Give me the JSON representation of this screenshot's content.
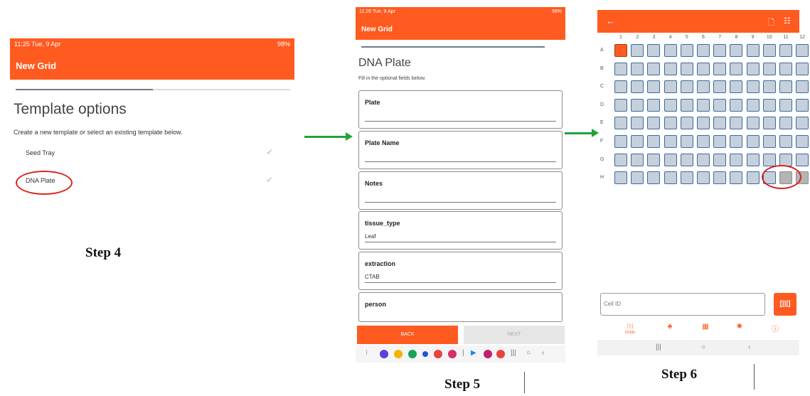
{
  "step4": {
    "status_left": "11:25 Tue, 9 Apr",
    "status_right": "98%",
    "title": "New Grid",
    "progress": 0.5,
    "heading": "Template options",
    "subtitle": "Create a new template or select an existing template below.",
    "options": [
      "Seed Tray",
      "DNA Plate"
    ],
    "step_label": "Step 4"
  },
  "step5": {
    "status_left": "11:26 Tue, 9 Apr",
    "status_right": "98%",
    "title": "New Grid",
    "progress": 0.9,
    "heading": "DNA Plate",
    "subtitle": "Fill in the optional fields below.",
    "fields": [
      {
        "label": "Plate",
        "value": ""
      },
      {
        "label": "Plate Name",
        "value": ""
      },
      {
        "label": "Notes",
        "value": ""
      },
      {
        "label": "tissue_type",
        "value": "Leaf"
      },
      {
        "label": "extraction",
        "value": "CTAB"
      },
      {
        "label": "person",
        "value": ""
      }
    ],
    "back_label": "BACK",
    "next_label": "NEXT",
    "step_label": "Step 5"
  },
  "step6": {
    "columns": [
      "1",
      "2",
      "3",
      "4",
      "5",
      "6",
      "7",
      "8",
      "9",
      "10",
      "11",
      "12"
    ],
    "rows": [
      "A",
      "B",
      "C",
      "D",
      "E",
      "F",
      "G",
      "H"
    ],
    "selected_cell": "A1",
    "unavailable_cells": [
      "H11",
      "H12"
    ],
    "cell_id_placeholder": "Cell ID",
    "nav": [
      {
        "icon": "grid-icon",
        "label": "Grids"
      },
      {
        "icon": "tree-icon",
        "label": ""
      },
      {
        "icon": "storage-icon",
        "label": ""
      },
      {
        "icon": "gear-icon",
        "label": ""
      },
      {
        "icon": "info-icon",
        "label": ""
      }
    ],
    "step_label": "Step 6"
  },
  "colors": {
    "accent": "#ff5a1f",
    "cell": "#c5d0dc",
    "cell_border": "#3d6a98",
    "grey_cell": "#b4b4b4",
    "annotation_ring": "#d9231f",
    "arrow": "#20a33a"
  }
}
